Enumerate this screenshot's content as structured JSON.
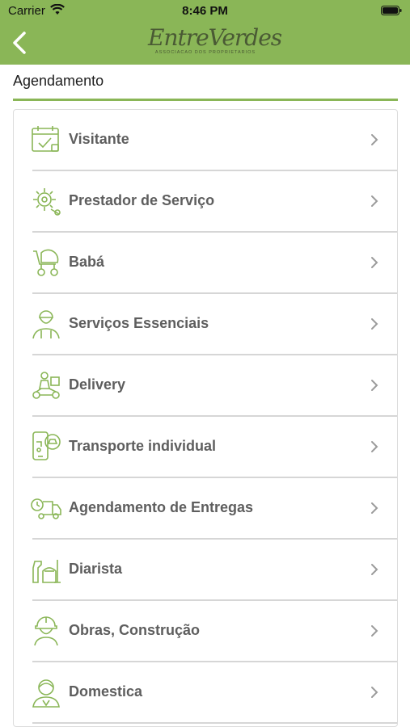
{
  "status_bar": {
    "carrier": "Carrier",
    "time": "8:46 PM"
  },
  "header": {
    "logo_text": "EntreVerdes",
    "logo_subtitle": "ASSOCIACAO DOS PROPRIETARIOS",
    "back_icon": "chevron-left-icon"
  },
  "section": {
    "title": "Agendamento"
  },
  "colors": {
    "brand_green": "#8ab657",
    "icon_green": "#8ab657",
    "label_gray": "#5e5e5e"
  },
  "items": [
    {
      "label": "Visitante",
      "icon": "calendar-check-icon"
    },
    {
      "label": "Prestador de Serviço",
      "icon": "tools-gear-icon"
    },
    {
      "label": "Babá",
      "icon": "stroller-icon"
    },
    {
      "label": "Serviços Essenciais",
      "icon": "worker-icon"
    },
    {
      "label": "Delivery",
      "icon": "delivery-scooter-icon"
    },
    {
      "label": "Transporte individual",
      "icon": "ride-app-icon"
    },
    {
      "label": "Agendamento de Entregas",
      "icon": "delivery-truck-clock-icon"
    },
    {
      "label": "Diarista",
      "icon": "cleaning-supplies-icon"
    },
    {
      "label": "Obras, Construção",
      "icon": "construction-worker-icon"
    },
    {
      "label": "Domestica",
      "icon": "housekeeper-icon"
    }
  ]
}
